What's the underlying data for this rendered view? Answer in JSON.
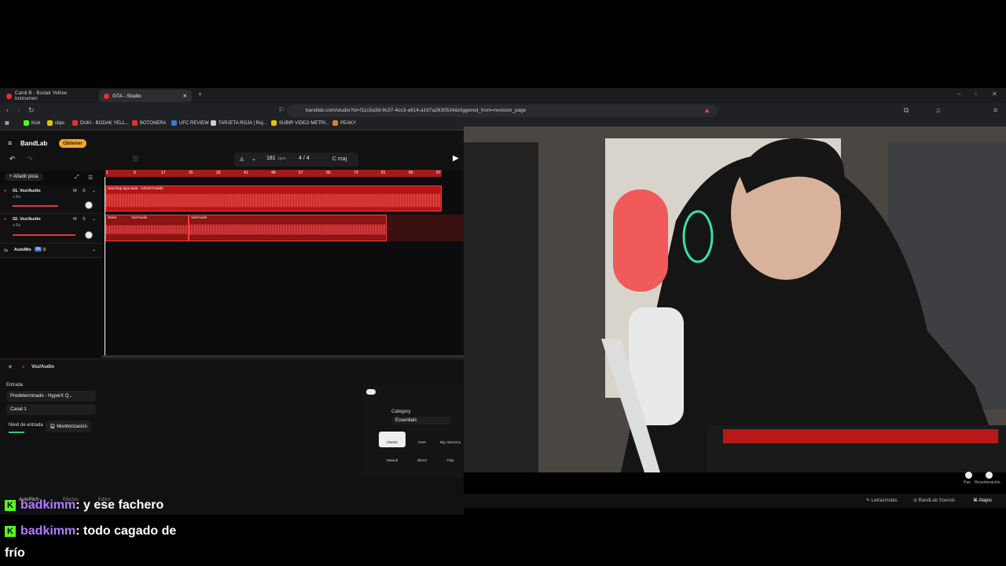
{
  "browser": {
    "tabs": [
      {
        "label": "Cardi B - Bodak Yellow Instrumen",
        "active": false
      },
      {
        "label": "GTA - Studio",
        "active": true
      }
    ],
    "url": "bandlab.com/studio?id=f11c5a3d-9c37-4cc3-a614-a167a2630534&triggered_from=revision_page",
    "bookmarks": [
      "Kick",
      "clips",
      "DUKI - BODAK YELL...",
      "BOTONERA",
      "UFC REVIEW",
      "TARJETA ROJA | Roj...",
      "SUBIR VIDEO METRI...",
      "PEAKY"
    ]
  },
  "studio": {
    "logo": "BandLab",
    "obtener": "Obtener",
    "bpm": "181",
    "bpm_unit": "bpm",
    "time_sig": "4 / 4",
    "key": "C maj",
    "add_track": "Añadir pista",
    "ruler_marks": [
      "1",
      "9",
      "17",
      "25",
      "33",
      "41",
      "49",
      "57",
      "65",
      "73",
      "81",
      "89",
      "97"
    ],
    "tracks": [
      {
        "name": "01. Voz/Audio",
        "fx": "+ Fx",
        "mute": "M",
        "solo": "S"
      },
      {
        "name": "02. Voz/Audio",
        "fx": "+ Fx",
        "mute": "M",
        "solo": "S"
      }
    ],
    "regions": {
      "r1": "Hard bop type beat - CRUSTCelebi",
      "r2": "Soloe",
      "r3": "Voz/Audio",
      "r4": "Voz/Audio"
    },
    "automix": "AutoMix",
    "automix_badge": "IA",
    "panel": {
      "title": "Voz/Audio",
      "entrada": "Entrada",
      "input_device": "Predeterminado - HyperX Q...",
      "channel": "Canal 1",
      "nivel": "Nivel de entrada",
      "monitor": "Monitorización",
      "category": "Category",
      "category_value": "Essentials",
      "presets": [
        "Classic",
        "Duet",
        "Big Harmony",
        "Natural",
        "Blend",
        "Chip"
      ],
      "tabs": [
        "AutoPitch",
        "Efectos",
        "Editor"
      ],
      "right_controls": [
        "Pan",
        "Reverberación"
      ],
      "bottom": [
        "Letras/notas",
        "BandLab Sounds",
        "Atajos"
      ]
    }
  },
  "chat": [
    {
      "user": "badkimm",
      "message": ": y ese fachero"
    },
    {
      "user": "badkimm",
      "message": ": todo cagado de"
    },
    {
      "user": "",
      "message": "frío"
    }
  ]
}
